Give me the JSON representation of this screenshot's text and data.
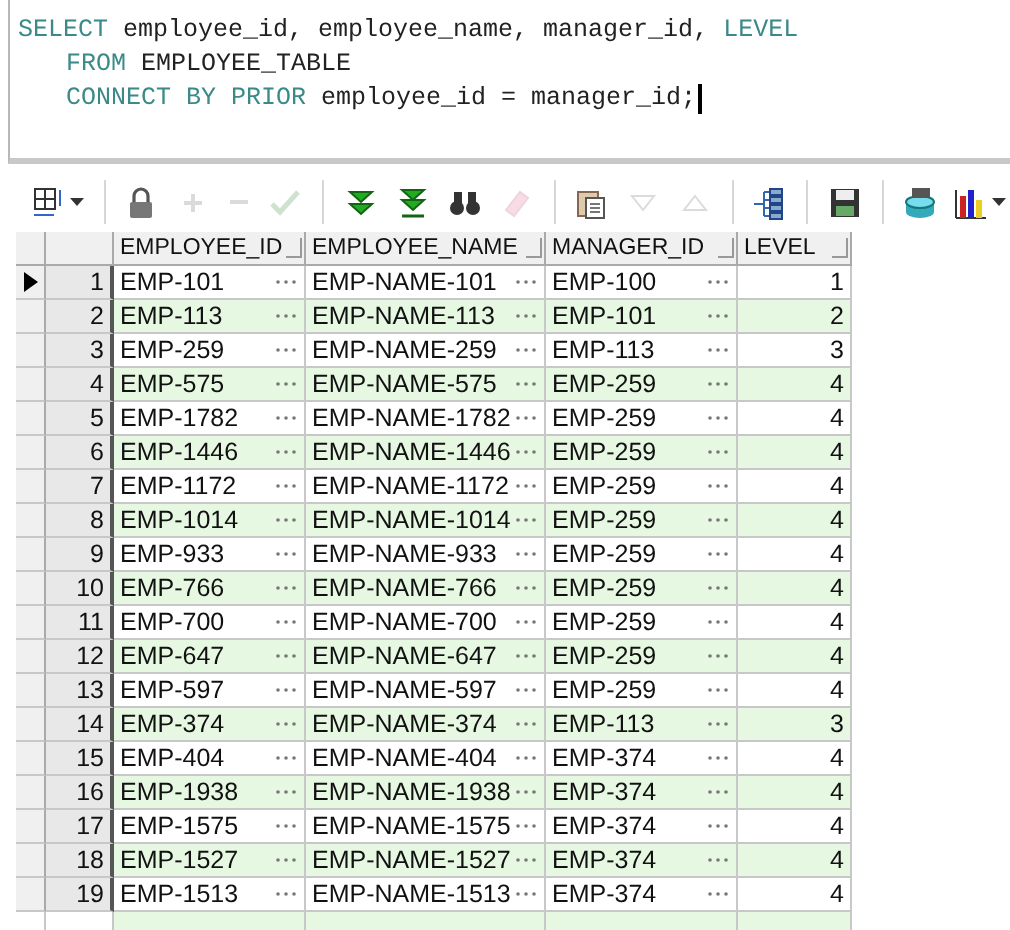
{
  "editor": {
    "lines": [
      {
        "indent": false,
        "tokens": [
          {
            "kind": "keyword",
            "text": "SELECT"
          },
          {
            "kind": "plain",
            "text": " employee_id, employee_name, manager_id, "
          },
          {
            "kind": "keyword",
            "text": "LEVEL"
          }
        ]
      },
      {
        "indent": true,
        "tokens": [
          {
            "kind": "keyword",
            "text": "FROM"
          },
          {
            "kind": "plain",
            "text": " EMPLOYEE_TABLE"
          }
        ]
      },
      {
        "indent": true,
        "tokens": [
          {
            "kind": "keyword",
            "text": "CONNECT BY PRIOR"
          },
          {
            "kind": "plain",
            "text": " employee_id = manager_id;"
          }
        ]
      }
    ]
  },
  "toolbar": [
    {
      "kind": "grid",
      "disabled": false,
      "dropdown": true
    },
    {
      "kind": "separator"
    },
    {
      "kind": "lock",
      "disabled": false,
      "dropdown": false
    },
    {
      "kind": "plus",
      "disabled": true,
      "dropdown": false
    },
    {
      "kind": "minus",
      "disabled": true,
      "dropdown": false
    },
    {
      "kind": "check",
      "disabled": true,
      "dropdown": false
    },
    {
      "kind": "separator"
    },
    {
      "kind": "fetch-next",
      "disabled": false,
      "dropdown": false
    },
    {
      "kind": "fetch-last",
      "disabled": false,
      "dropdown": false
    },
    {
      "kind": "binoculars",
      "disabled": false,
      "dropdown": false
    },
    {
      "kind": "eraser",
      "disabled": true,
      "dropdown": false
    },
    {
      "kind": "separator"
    },
    {
      "kind": "clipboard",
      "disabled": false,
      "dropdown": false
    },
    {
      "kind": "down",
      "disabled": true,
      "dropdown": false
    },
    {
      "kind": "up",
      "disabled": true,
      "dropdown": false
    },
    {
      "kind": "separator"
    },
    {
      "kind": "tree",
      "disabled": false,
      "dropdown": false
    },
    {
      "kind": "separator"
    },
    {
      "kind": "save",
      "disabled": false,
      "dropdown": false
    },
    {
      "kind": "separator"
    },
    {
      "kind": "database",
      "disabled": false,
      "dropdown": false
    },
    {
      "kind": "chart",
      "disabled": false,
      "dropdown": true
    }
  ],
  "grid": {
    "columns": [
      {
        "label": "EMPLOYEE_ID",
        "kind": "text"
      },
      {
        "label": "EMPLOYEE_NAME",
        "kind": "text"
      },
      {
        "label": "MANAGER_ID",
        "kind": "text"
      },
      {
        "label": "LEVEL",
        "kind": "number"
      }
    ],
    "rows": [
      {
        "number": "1",
        "current": true,
        "cells": [
          "EMP-101",
          "EMP-NAME-101",
          "EMP-100",
          "1"
        ]
      },
      {
        "number": "2",
        "current": false,
        "cells": [
          "EMP-113",
          "EMP-NAME-113",
          "EMP-101",
          "2"
        ]
      },
      {
        "number": "3",
        "current": false,
        "cells": [
          "EMP-259",
          "EMP-NAME-259",
          "EMP-113",
          "3"
        ]
      },
      {
        "number": "4",
        "current": false,
        "cells": [
          "EMP-575",
          "EMP-NAME-575",
          "EMP-259",
          "4"
        ]
      },
      {
        "number": "5",
        "current": false,
        "cells": [
          "EMP-1782",
          "EMP-NAME-1782",
          "EMP-259",
          "4"
        ]
      },
      {
        "number": "6",
        "current": false,
        "cells": [
          "EMP-1446",
          "EMP-NAME-1446",
          "EMP-259",
          "4"
        ]
      },
      {
        "number": "7",
        "current": false,
        "cells": [
          "EMP-1172",
          "EMP-NAME-1172",
          "EMP-259",
          "4"
        ]
      },
      {
        "number": "8",
        "current": false,
        "cells": [
          "EMP-1014",
          "EMP-NAME-1014",
          "EMP-259",
          "4"
        ]
      },
      {
        "number": "9",
        "current": false,
        "cells": [
          "EMP-933",
          "EMP-NAME-933",
          "EMP-259",
          "4"
        ]
      },
      {
        "number": "10",
        "current": false,
        "cells": [
          "EMP-766",
          "EMP-NAME-766",
          "EMP-259",
          "4"
        ]
      },
      {
        "number": "11",
        "current": false,
        "cells": [
          "EMP-700",
          "EMP-NAME-700",
          "EMP-259",
          "4"
        ]
      },
      {
        "number": "12",
        "current": false,
        "cells": [
          "EMP-647",
          "EMP-NAME-647",
          "EMP-259",
          "4"
        ]
      },
      {
        "number": "13",
        "current": false,
        "cells": [
          "EMP-597",
          "EMP-NAME-597",
          "EMP-259",
          "4"
        ]
      },
      {
        "number": "14",
        "current": false,
        "cells": [
          "EMP-374",
          "EMP-NAME-374",
          "EMP-113",
          "3"
        ]
      },
      {
        "number": "15",
        "current": false,
        "cells": [
          "EMP-404",
          "EMP-NAME-404",
          "EMP-374",
          "4"
        ]
      },
      {
        "number": "16",
        "current": false,
        "cells": [
          "EMP-1938",
          "EMP-NAME-1938",
          "EMP-374",
          "4"
        ]
      },
      {
        "number": "17",
        "current": false,
        "cells": [
          "EMP-1575",
          "EMP-NAME-1575",
          "EMP-374",
          "4"
        ]
      },
      {
        "number": "18",
        "current": false,
        "cells": [
          "EMP-1527",
          "EMP-NAME-1527",
          "EMP-374",
          "4"
        ]
      },
      {
        "number": "19",
        "current": false,
        "cells": [
          "EMP-1513",
          "EMP-NAME-1513",
          "EMP-374",
          "4"
        ]
      }
    ]
  }
}
